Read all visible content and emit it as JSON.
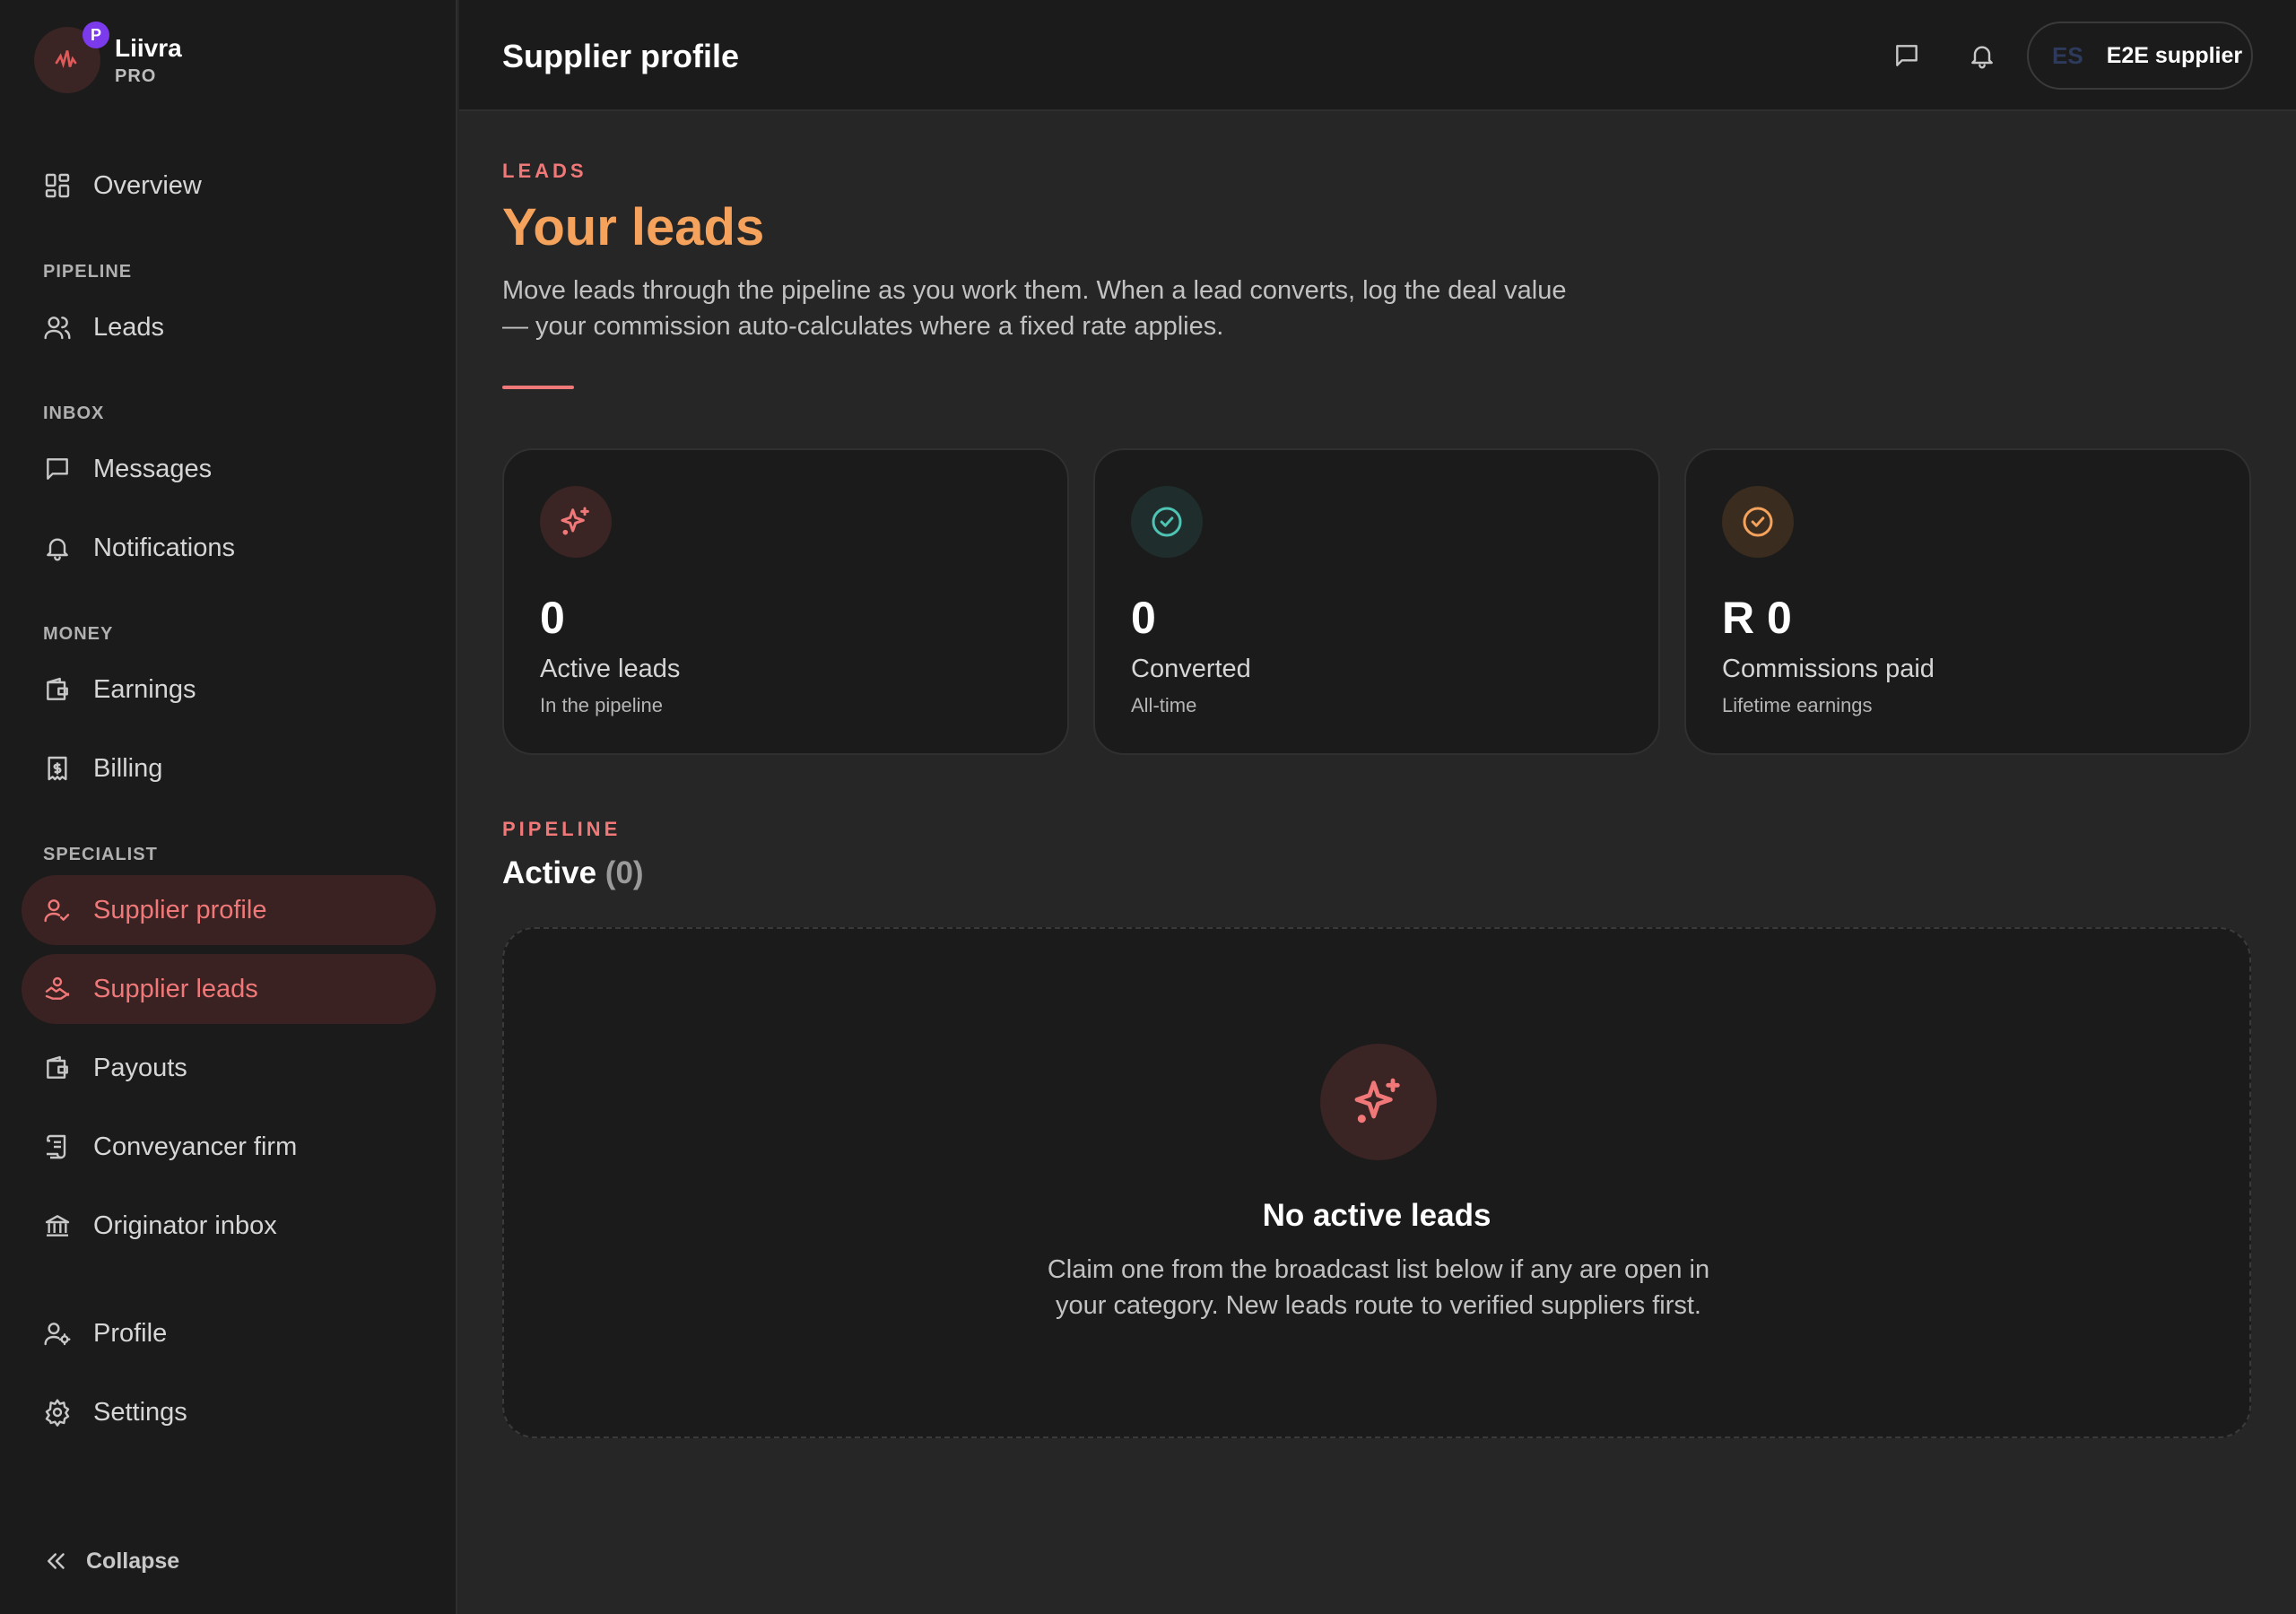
{
  "brand": {
    "name": "Liivra",
    "tier": "PRO",
    "badge": "P"
  },
  "sidebar": {
    "items": [
      {
        "label": "Overview"
      },
      {
        "section": "PIPELINE"
      },
      {
        "label": "Leads"
      },
      {
        "section": "INBOX"
      },
      {
        "label": "Messages"
      },
      {
        "label": "Notifications"
      },
      {
        "section": "MONEY"
      },
      {
        "label": "Earnings"
      },
      {
        "label": "Billing"
      },
      {
        "section": "SPECIALIST"
      },
      {
        "label": "Supplier profile",
        "active": true
      },
      {
        "label": "Supplier leads",
        "active": true
      },
      {
        "label": "Payouts"
      },
      {
        "label": "Conveyancer firm"
      },
      {
        "label": "Originator inbox"
      },
      {
        "label": "Profile"
      },
      {
        "label": "Settings"
      }
    ],
    "collapse_label": "Collapse"
  },
  "header": {
    "title": "Supplier profile",
    "user_initials": "ES",
    "user_name": "E2E supplier"
  },
  "hero": {
    "eyebrow": "LEADS",
    "title": "Your leads",
    "description": "Move leads through the pipeline as you work them. When a lead converts, log the deal value — your commission auto-calculates where a fixed rate applies."
  },
  "stats": [
    {
      "value": "0",
      "label": "Active leads",
      "sub": "In the pipeline",
      "icon": "sparkle-icon",
      "color": "#f07878"
    },
    {
      "value": "0",
      "label": "Converted",
      "sub": "All-time",
      "icon": "check-circle-icon",
      "color": "#4fc4b4"
    },
    {
      "value": "R 0",
      "label": "Commissions paid",
      "sub": "Lifetime earnings",
      "icon": "check-circle-icon",
      "color": "#f5a35c"
    }
  ],
  "pipeline": {
    "eyebrow": "PIPELINE",
    "title": "Active",
    "count": "(0)",
    "empty_title": "No active leads",
    "empty_description": "Claim one from the broadcast list below if any are open in your category. New leads route to verified suppliers first."
  },
  "colors": {
    "accent": "#f07878",
    "hero": "#f5a35c",
    "teal": "#4fc4b4",
    "badge": "#7c3aed"
  }
}
